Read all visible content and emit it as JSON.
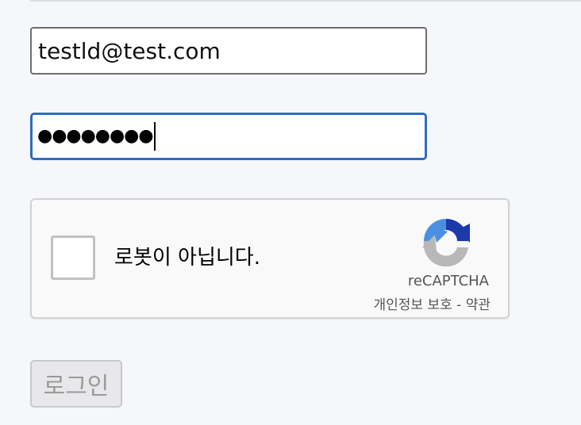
{
  "form": {
    "email_value": "testld@test.com",
    "password_masked": "●●●●●●●●",
    "login_button_label": "로그인"
  },
  "recaptcha": {
    "checkbox_label": "로봇이 아닙니다.",
    "brand": "reCAPTCHA",
    "privacy_link": "개인정보 보호",
    "separator": " - ",
    "terms_link": "약관",
    "checked": false
  },
  "colors": {
    "focus_border": "#2f6cc4",
    "recaptcha_blue": "#1c3aa9",
    "recaptcha_lightblue": "#4a90e2",
    "recaptcha_gray": "#b8b8b8"
  }
}
